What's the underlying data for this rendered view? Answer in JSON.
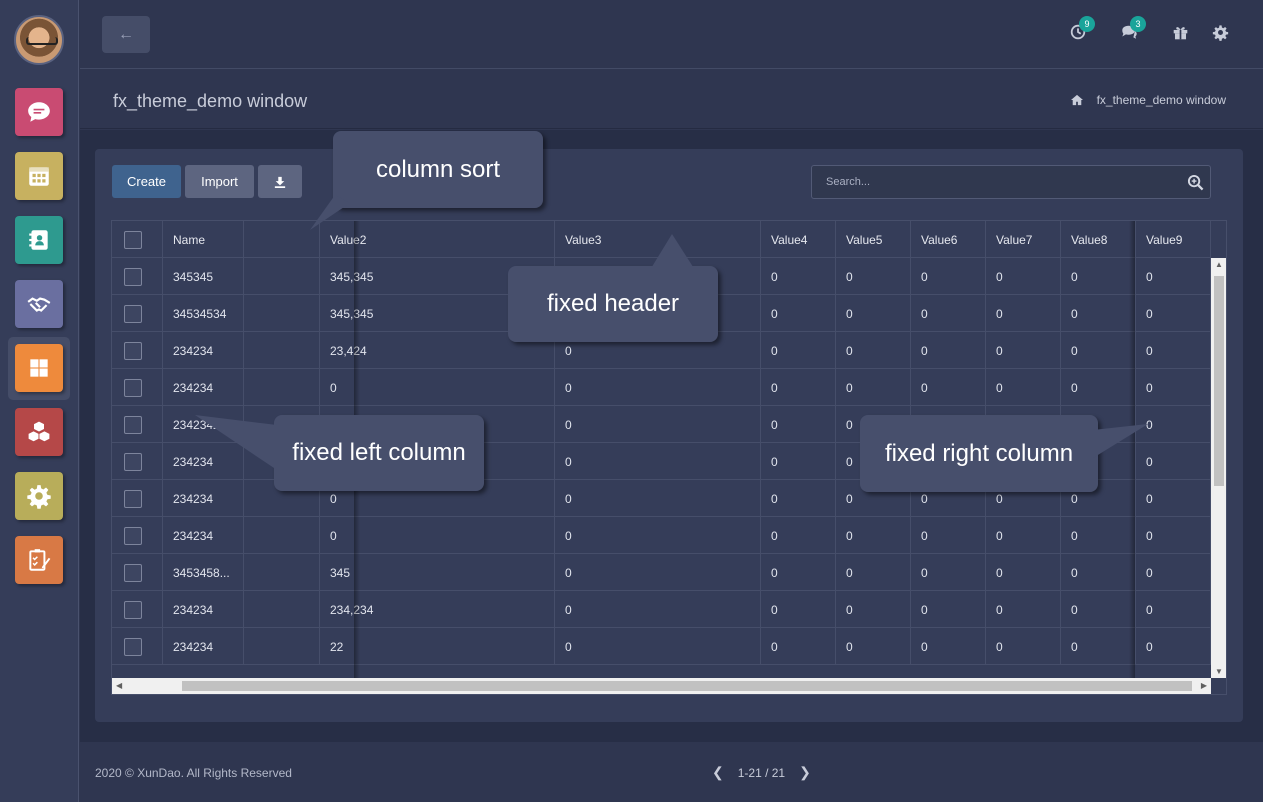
{
  "topbar": {
    "back_label": "←",
    "history_badge": "9",
    "messages_badge": "3"
  },
  "title": {
    "page_title": "fx_theme_demo window",
    "breadcrumb": "fx_theme_demo window"
  },
  "toolbar": {
    "create_label": "Create",
    "import_label": "Import"
  },
  "search": {
    "placeholder": "Search..."
  },
  "table": {
    "columns": [
      "Name",
      "",
      "Value2",
      "Value3",
      "Value4",
      "Value5",
      "Value6",
      "Value7",
      "Value8",
      "Value9"
    ],
    "rows": [
      [
        "345345",
        "",
        "345,345",
        "",
        "0",
        "0",
        "0",
        "0",
        "0",
        "0"
      ],
      [
        "34534534",
        "",
        "345,345",
        "",
        "0",
        "0",
        "0",
        "0",
        "0",
        "0"
      ],
      [
        "234234",
        "",
        "23,424",
        "0",
        "0",
        "0",
        "0",
        "0",
        "0",
        "0"
      ],
      [
        "234234",
        "",
        "0",
        "0",
        "0",
        "0",
        "0",
        "0",
        "0",
        "0"
      ],
      [
        "2342342",
        "",
        "",
        "0",
        "0",
        "0",
        "0",
        "0",
        "0",
        "0"
      ],
      [
        "234234",
        "",
        "",
        "0",
        "0",
        "0",
        "0",
        "0",
        "0",
        "0"
      ],
      [
        "234234",
        "",
        "0",
        "0",
        "0",
        "0",
        "0",
        "0",
        "0",
        "0"
      ],
      [
        "234234",
        "",
        "0",
        "0",
        "0",
        "0",
        "0",
        "0",
        "0",
        "0"
      ],
      [
        "3453458...",
        "",
        "345",
        "0",
        "0",
        "0",
        "0",
        "0",
        "0",
        "0"
      ],
      [
        "234234",
        "",
        "234,234",
        "0",
        "0",
        "0",
        "0",
        "0",
        "0",
        "0"
      ],
      [
        "234234",
        "",
        "22",
        "0",
        "0",
        "0",
        "0",
        "0",
        "0",
        "0"
      ]
    ]
  },
  "callouts": {
    "sort": "column sort",
    "header": "fixed header",
    "left": "fixed left column",
    "right": "fixed right column"
  },
  "footer": {
    "copyright": "2020 © XunDao. All Rights Reserved",
    "page_info": "1-21 / 21"
  },
  "colors": {
    "chat": "#c94b72",
    "calendar": "#c7b160",
    "contacts": "#2e9a8f",
    "deals": "#6a6fa0",
    "apps": "#ee8a3c",
    "inventory": "#b54848",
    "settings": "#b8ad5a",
    "tasks": "#d87945"
  }
}
